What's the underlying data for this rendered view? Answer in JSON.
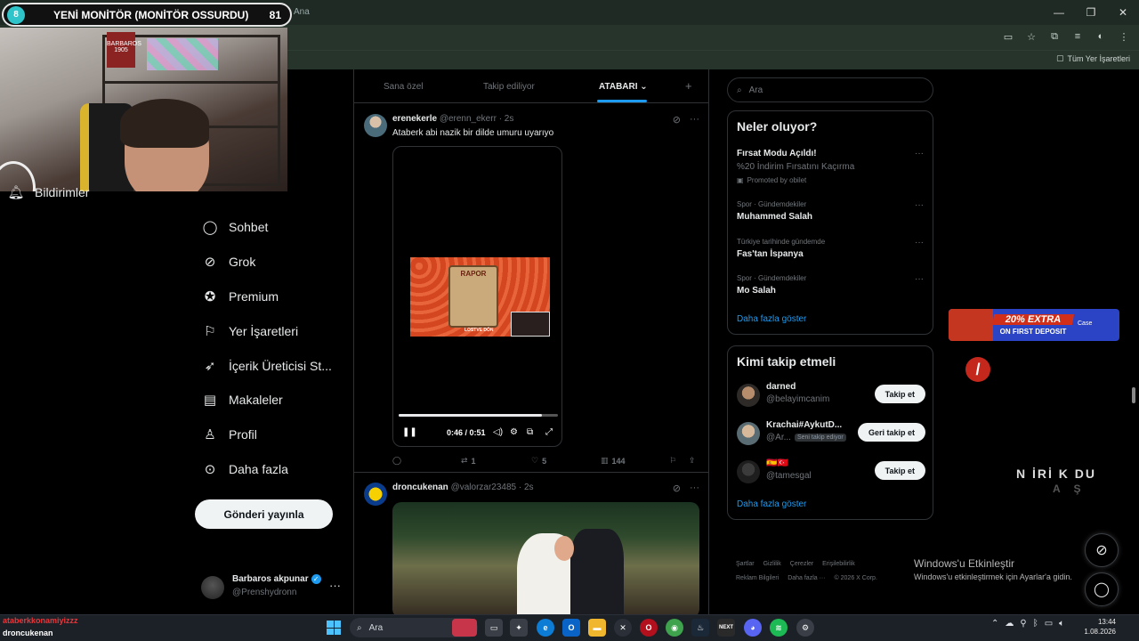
{
  "browser": {
    "tab_text": "Ana",
    "bookmarks_all": "Tüm Yer İşaretleri"
  },
  "overlay": {
    "badge": "8",
    "title": "YENİ MONİTÖR (MONİTÖR OSSURDU)",
    "count": "81"
  },
  "webcam": {
    "sign_text": "BARBAROS 1905"
  },
  "nav": {
    "items": [
      {
        "label": "Bildirimler",
        "icon": "bell-icon"
      },
      {
        "label": "Sohbet",
        "icon": "chat-icon"
      },
      {
        "label": "Grok",
        "icon": "grok-icon"
      },
      {
        "label": "Premium",
        "icon": "premium-icon"
      },
      {
        "label": "Yer İşaretleri",
        "icon": "bookmark-icon"
      },
      {
        "label": "İçerik Üreticisi St...",
        "icon": "rocket-icon"
      },
      {
        "label": "Makaleler",
        "icon": "article-icon"
      },
      {
        "label": "Profil",
        "icon": "profile-icon"
      },
      {
        "label": "Daha fazla",
        "icon": "more-circle-icon"
      }
    ],
    "post_button": "Gönderi yayınla",
    "account": {
      "name": "Barbaros akpunar",
      "handle": "@Prenshydronn",
      "more": "···"
    }
  },
  "timeline": {
    "tabs": [
      "Sana özel",
      "Takip ediliyor",
      "ATABARI"
    ],
    "active_tab": "ATABARI",
    "add_tab": "+",
    "tweets": [
      {
        "name": "erenekerle",
        "handle": "@erenn_ekerr",
        "time": "· 2s",
        "text": "Ataberk abi nazik bir dilde umuru uyarıyo",
        "video": {
          "paper_title": "RAPOR",
          "caption": "LOSTVE DÖN",
          "time": "0:46 / 0:51",
          "progress": 0.9
        },
        "stats": {
          "retweets": "1",
          "likes": "5",
          "views": "144"
        }
      },
      {
        "name": "droncukenan",
        "handle": "@valorzar23485",
        "time": "· 2s"
      }
    ]
  },
  "sidebar": {
    "search_placeholder": "Ara",
    "whats_happening": {
      "title": "Neler oluyor?",
      "trends": [
        {
          "context": "",
          "title": "Fırsat Modu Açıldı!",
          "subtitle": "%20 İndirim Fırsatını Kaçırma",
          "promo": "Promoted by obilet"
        },
        {
          "context": "Spor · Gündemdekiler",
          "title": "Muhammed Salah"
        },
        {
          "context": "Türkiye tarihinde gündemde",
          "title": "Fas'tan İspanya"
        },
        {
          "context": "Spor · Gündemdekiler",
          "title": "Mo Salah"
        }
      ],
      "show_more": "Daha fazla göster"
    },
    "who_to_follow": {
      "title": "Kimi takip etmeli",
      "accounts": [
        {
          "name": "darned",
          "handle": "@belayimcanim",
          "button": "Takip et",
          "tag": ""
        },
        {
          "name": "Krachai#AykutD...",
          "handle": "@Ar...",
          "button": "Geri takip et",
          "tag": "Seni takip ediyor"
        },
        {
          "name": "🇪🇸🇹🇷",
          "handle": "@tamesgal",
          "button": "Takip et",
          "tag": ""
        }
      ],
      "show_more": "Daha fazla göster"
    },
    "footer": [
      "Şartlar",
      "Gizlilik",
      "Çerezler",
      "Erişilebilirlik",
      "Reklam Bilgileri",
      "Daha fazla ···",
      "© 2026 X Corp."
    ]
  },
  "windows_activation": {
    "title": "Windows'u Etkinleştir",
    "subtitle": "Windows'u etkinleştirmek için Ayarlar'a gidin."
  },
  "stream_extras": {
    "promo_badge": "20% EXTRA",
    "promo_sub": "ON FIRST DEPOSIT",
    "promo_brand": "Case",
    "ghost_text": "N İRİ K DU",
    "ghost_text2": "A Ş"
  },
  "chat": [
    {
      "user": "ataberkkonamiyizzz",
      "text": ""
    },
    {
      "user": "droncukenan",
      "text": ""
    }
  ],
  "taskbar": {
    "search_placeholder": "Ara",
    "time": "13:44",
    "date": "1.08.2026"
  }
}
